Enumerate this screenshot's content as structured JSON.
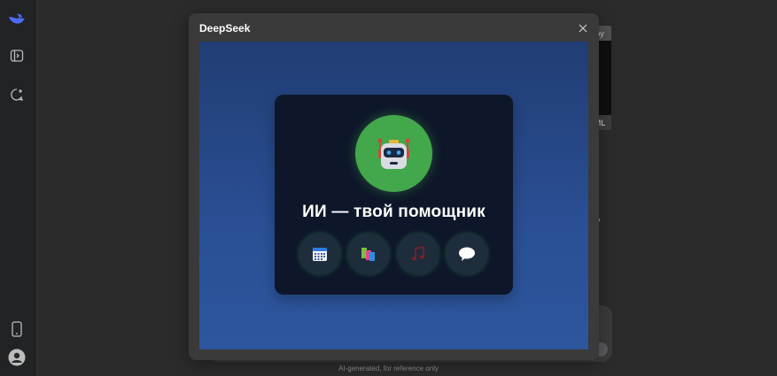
{
  "sidebar": {
    "icons": [
      "deepseek-whale-logo",
      "sidebar-toggle-icon",
      "new-chat-icon",
      "mobile-app-icon",
      "profile-avatar-icon"
    ]
  },
  "background": {
    "tag_label": "oy",
    "tag_ml": "ML",
    "partial_text": "y",
    "disclaimer": "AI-generated, for reference only"
  },
  "modal": {
    "title": "DeepSeek",
    "close_icon": "close-icon"
  },
  "preview": {
    "heading": "ИИ — твой помощник",
    "features": [
      "calendar-icon",
      "books-icon",
      "music-note-icon",
      "speech-bubble-icon"
    ],
    "colors": {
      "background_top": "#213d74",
      "background_bottom": "#2d569d",
      "card": "#0e1729",
      "robot_circle": "#43a74b"
    }
  }
}
